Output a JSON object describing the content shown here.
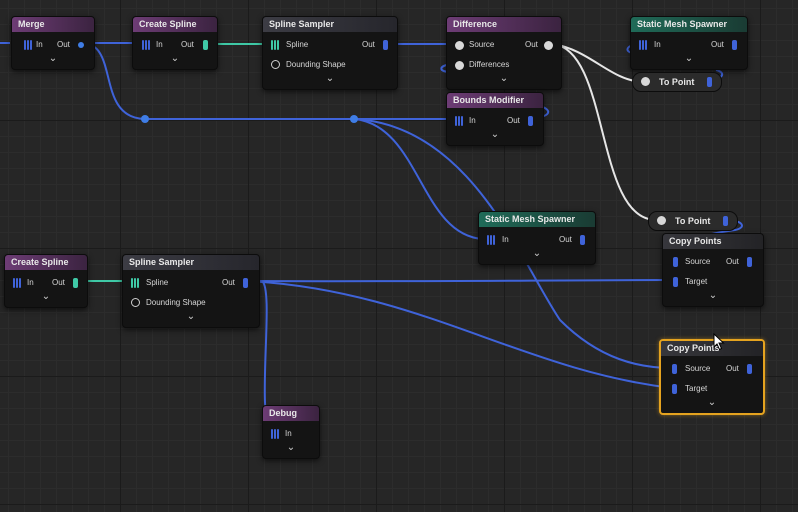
{
  "colors": {
    "wire_blue": "#3f63d9",
    "wire_teal": "#3fc9a6",
    "wire_white": "#e6e6e6",
    "selection": "#e5a31f",
    "header_purple": "#6d3c75",
    "header_teal": "#1f6b58",
    "header_slate": "#3c3c44"
  },
  "nodes": {
    "merge_1": {
      "title": "Merge",
      "in": "In",
      "out": "Out"
    },
    "create_spline_1": {
      "title": "Create Spline",
      "in": "In",
      "out": "Out"
    },
    "spline_sampler_1": {
      "title": "Spline Sampler",
      "spline": "Spline",
      "bounding": "Dounding Shape",
      "out": "Out"
    },
    "difference": {
      "title": "Difference",
      "source": "Source",
      "differences": "Differences",
      "out": "Out"
    },
    "static_mesh_spawner_1": {
      "title": "Static Mesh Spawner",
      "in": "In",
      "out": "Out"
    },
    "to_point_1": {
      "title": "To Point"
    },
    "bounds_modifier": {
      "title": "Bounds Modifier",
      "in": "In",
      "out": "Out"
    },
    "static_mesh_spawner_2": {
      "title": "Static Mesh Spawner",
      "in": "In",
      "out": "Out"
    },
    "to_point_2": {
      "title": "To Point"
    },
    "copy_points_1": {
      "title": "Copy Points",
      "source": "Source",
      "target": "Target",
      "out": "Out"
    },
    "create_spline_2": {
      "title": "Create Spline",
      "in": "In",
      "out": "Out"
    },
    "spline_sampler_2": {
      "title": "Spline Sampler",
      "spline": "Spline",
      "bounding": "Dounding Shape",
      "out": "Out"
    },
    "copy_points_2": {
      "title": "Copy Points",
      "source": "Source",
      "target": "Target",
      "out": "Out"
    },
    "debug": {
      "title": "Debug",
      "in": "In"
    }
  },
  "icons": {
    "expand": "chevron-down-icon",
    "pin_point": "point-data-pin-icon",
    "pin_spline": "spline-data-pin-icon",
    "pin_any": "any-data-pin-icon",
    "pin_spatial": "spatial-data-pin-icon",
    "cursor": "mouse-cursor-icon"
  },
  "chevron_glyph": "⌄"
}
